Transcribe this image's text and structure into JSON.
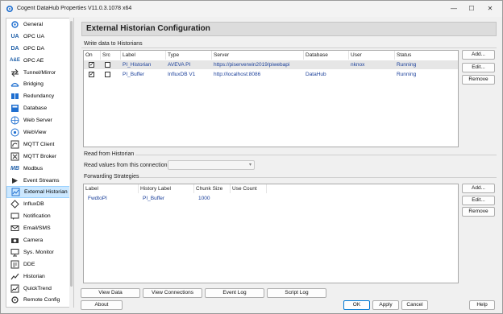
{
  "window": {
    "title": "Cogent DataHub Properties V11.0.3.1078 x64",
    "min": "—",
    "max": "☐",
    "close": "✕"
  },
  "sidebar": {
    "items": [
      {
        "label": "General",
        "icon": "gear"
      },
      {
        "label": "OPC UA",
        "icon": "UA"
      },
      {
        "label": "OPC DA",
        "icon": "DA"
      },
      {
        "label": "OPC AE",
        "icon": "A&E"
      },
      {
        "label": "Tunnel/Mirror",
        "icon": "tunnel"
      },
      {
        "label": "Bridging",
        "icon": "bridge"
      },
      {
        "label": "Redundancy",
        "icon": "redundancy"
      },
      {
        "label": "Database",
        "icon": "database"
      },
      {
        "label": "Web Server",
        "icon": "web-server"
      },
      {
        "label": "WebView",
        "icon": "webview"
      },
      {
        "label": "MQTT Client",
        "icon": "mqtt-client"
      },
      {
        "label": "MQTT Broker",
        "icon": "mqtt-broker"
      },
      {
        "label": "Modbus",
        "icon": "MB"
      },
      {
        "label": "Event Streams",
        "icon": "event-streams"
      },
      {
        "label": "External Historian",
        "icon": "external-historian"
      },
      {
        "label": "InfluxDB",
        "icon": "influxdb"
      },
      {
        "label": "Notification",
        "icon": "notification"
      },
      {
        "label": "Email/SMS",
        "icon": "email"
      },
      {
        "label": "Camera",
        "icon": "camera"
      },
      {
        "label": "Sys. Monitor",
        "icon": "monitor"
      },
      {
        "label": "DDE",
        "icon": "dde"
      },
      {
        "label": "Historian",
        "icon": "historian"
      },
      {
        "label": "QuickTrend",
        "icon": "quicktrend"
      },
      {
        "label": "Remote Config",
        "icon": "remote-config"
      }
    ],
    "active": "External Historian"
  },
  "header": {
    "title": "External Historian Configuration"
  },
  "write": {
    "section": "Write data to Historians",
    "columns": [
      "On",
      "Src",
      "Label",
      "Type",
      "Server",
      "Database",
      "User",
      "Status"
    ],
    "rows": [
      {
        "on": "✓",
        "src": "",
        "label": "PI_Historian",
        "type": "AVEVA PI",
        "server": "https://piserverwin2019/piwebapi",
        "database": "",
        "user": "nknox",
        "status": "Running"
      },
      {
        "on": "✓",
        "src": "",
        "label": "PI_Buffer",
        "type": "InfluxDB V1",
        "server": "http://localhost:8086",
        "database": "DataHub",
        "user": "",
        "status": "Running"
      }
    ],
    "buttons": {
      "add": "Add...",
      "edit": "Edit...",
      "remove": "Remove"
    }
  },
  "read": {
    "section": "Read from Historian",
    "label": "Read values from this connection",
    "value": ""
  },
  "forwarding": {
    "section": "Forwarding Strategies",
    "columns": [
      "Label",
      "History Label",
      "Chunk Size",
      "Use Count"
    ],
    "rows": [
      {
        "label": "FwdtoPI",
        "history_label": "PI_Buffer",
        "chunk_size": "1000",
        "use_count": ""
      }
    ],
    "buttons": {
      "add": "Add...",
      "edit": "Edit...",
      "remove": "Remove"
    }
  },
  "bottom": {
    "view_data": "View Data",
    "view_connections": "View Connections",
    "event_log": "Event Log",
    "script_log": "Script Log"
  },
  "footer": {
    "about": "About",
    "ok": "OK",
    "apply": "Apply",
    "cancel": "Cancel",
    "help": "Help"
  },
  "colors": {
    "link_text": "#1a3f9a",
    "selected_bg": "#cce8ff",
    "primary_border": "#0078d4"
  }
}
